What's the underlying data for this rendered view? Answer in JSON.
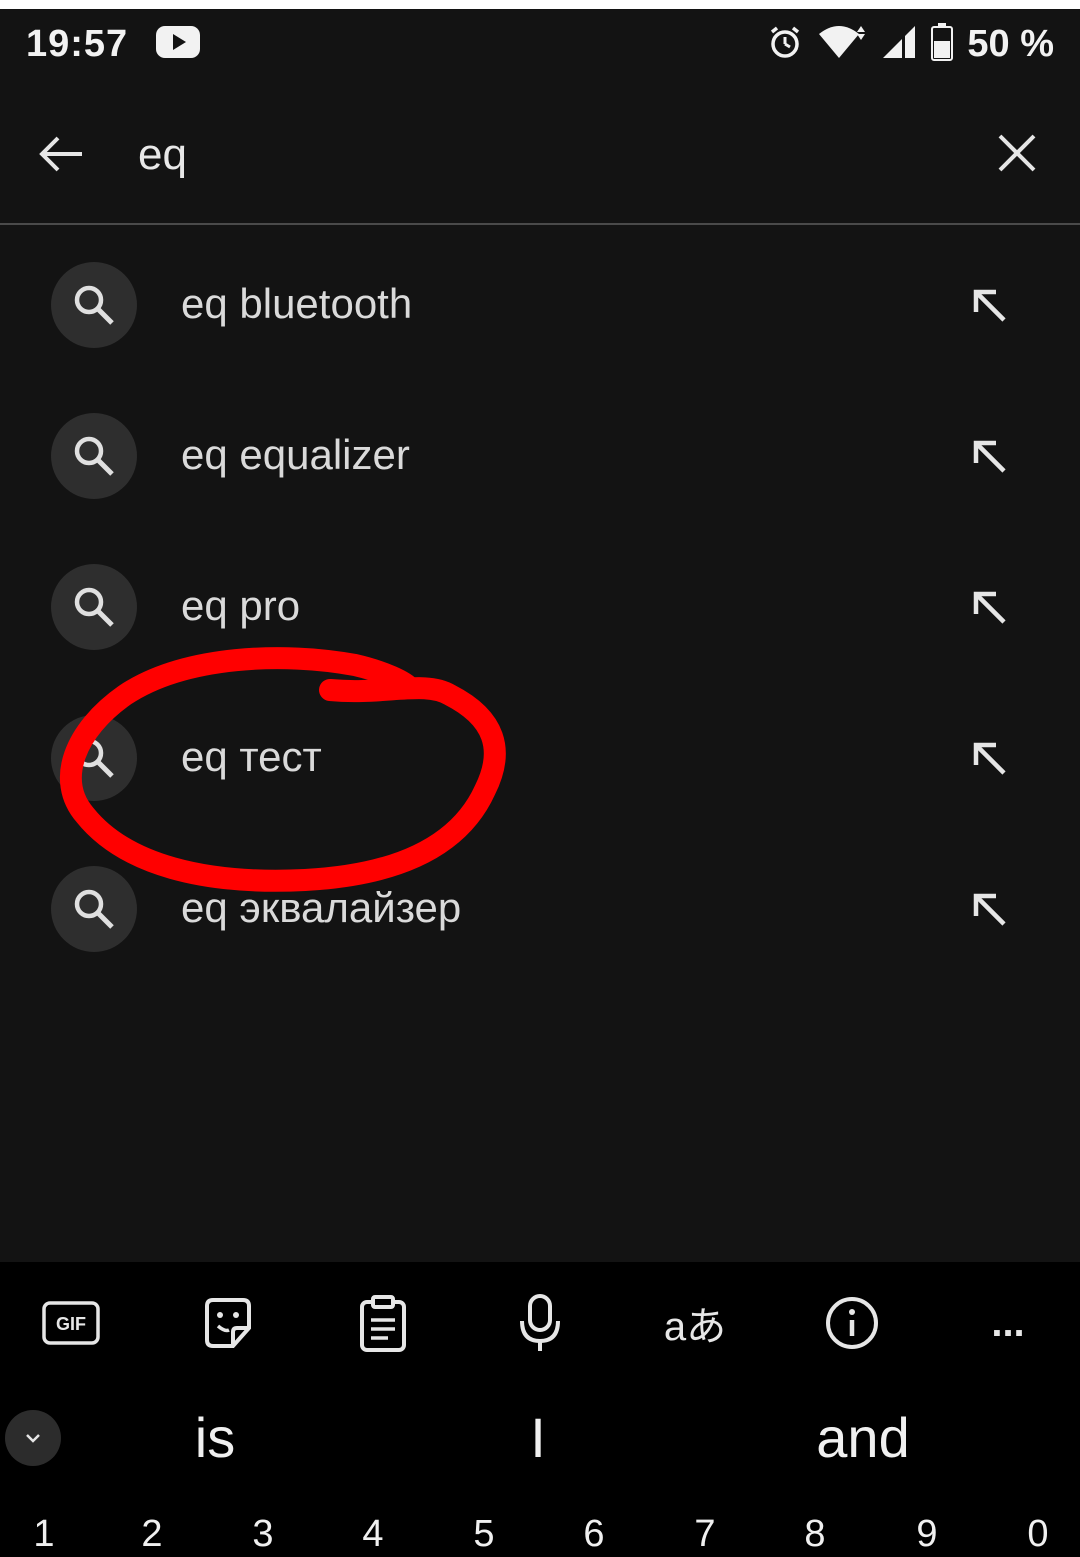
{
  "status_bar": {
    "time": "19:57",
    "battery": "50 %",
    "icons": [
      "youtube-icon",
      "alarm-icon",
      "wifi-icon",
      "signal-icon",
      "battery-icon"
    ]
  },
  "search": {
    "query": "eq",
    "back_icon": "arrow-left-icon",
    "clear_icon": "close-icon"
  },
  "suggestions": [
    {
      "text": "eq bluetooth",
      "icon": "search-icon",
      "action_icon": "arrow-up-left-icon"
    },
    {
      "text": "eq equalizer",
      "icon": "search-icon",
      "action_icon": "arrow-up-left-icon"
    },
    {
      "text": "eq pro",
      "icon": "search-icon",
      "action_icon": "arrow-up-left-icon"
    },
    {
      "text": "eq тест",
      "icon": "search-icon",
      "action_icon": "arrow-up-left-icon"
    },
    {
      "text": "eq эквалайзер",
      "icon": "search-icon",
      "action_icon": "arrow-up-left-icon"
    }
  ],
  "annotation": {
    "color": "#ff0000",
    "target": "eq тест"
  },
  "keyboard": {
    "toolbar": {
      "gif_label": "GIF",
      "translate_label": "aあ",
      "more_label": "...",
      "icons": [
        "gif-icon",
        "sticker-icon",
        "clipboard-icon",
        "microphone-icon",
        "translate-icon",
        "info-icon",
        "more-icon"
      ]
    },
    "suggestions": [
      "is",
      "I",
      "and"
    ],
    "numbers": [
      "1",
      "2",
      "3",
      "4",
      "5",
      "6",
      "7",
      "8",
      "9",
      "0"
    ]
  },
  "colors": {
    "background": "#131313",
    "keyboard_background": "#000000",
    "icon_circle": "#2e2e2e",
    "text": "#dadada"
  }
}
